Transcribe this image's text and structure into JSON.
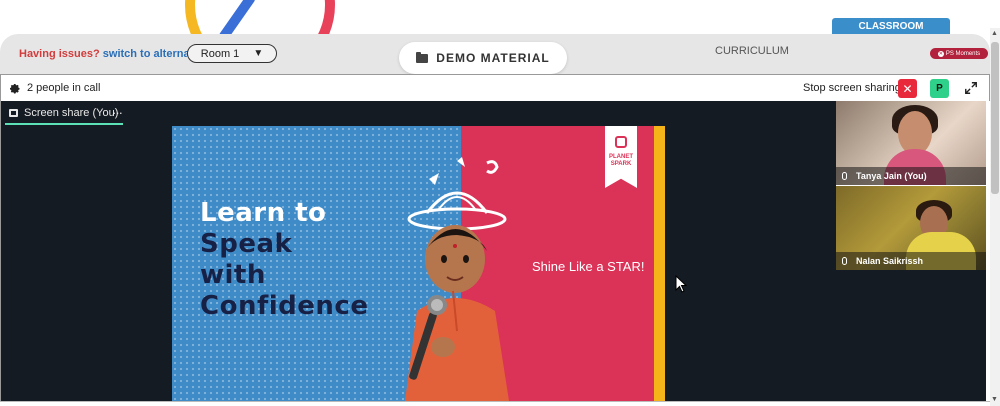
{
  "header": {
    "issue_text": "Having issues?",
    "alternate_link": "switch to alternate room",
    "room_select": "Room 1",
    "demo_button": "DEMO MATERIAL",
    "tab_curriculum": "CURRICULUM",
    "tab_classroom": "CLASSROOM",
    "moments_badge": "PS Moments"
  },
  "callbar": {
    "people_count": "2 people in call",
    "stop_sharing": "Stop screen sharing",
    "stop_icon": "close-icon",
    "avatar_letter": "P",
    "settings_icon": "gear-icon",
    "expand_icon": "expand-icon"
  },
  "screen_share": {
    "tab_label": "Screen share (You)",
    "menu_dots": "···"
  },
  "slide": {
    "line1": "Learn to",
    "line2": "Speak",
    "line3": "with",
    "line4": "Confidence",
    "tagline": "Shine Like a STAR!",
    "brand_line1": "PLANET",
    "brand_line2": "SPARK"
  },
  "participants": [
    {
      "name": "Tanya Jain (You)"
    },
    {
      "name": "Nalan Saikrissh"
    }
  ],
  "colors": {
    "accent_blue": "#3a8ec9",
    "stop_red": "#e8293c",
    "avatar_green": "#2fd18a",
    "slide_blue": "#3f8bc8",
    "slide_red": "#db3257",
    "slide_yellow": "#f4b41a",
    "share_underline": "#5ce0b5"
  }
}
